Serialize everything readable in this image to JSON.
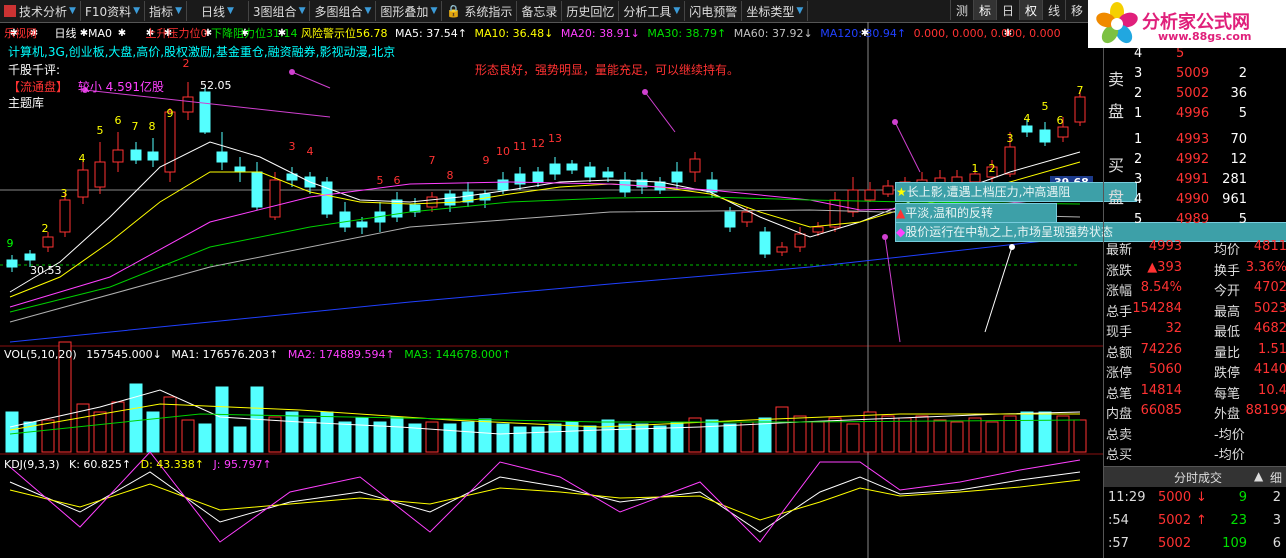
{
  "toolbar": {
    "items": [
      "技术分析",
      "F10资料",
      "指标",
      "日线",
      "3图组合",
      "多图组合",
      "图形叠加",
      "系统指示",
      "备忘录",
      "历史回忆",
      "分析工具",
      "闪电预警",
      "坐标类型"
    ],
    "right": [
      "测",
      "标",
      "日",
      "权",
      "线",
      "移"
    ]
  },
  "logo": {
    "text": "分析家公式网",
    "url": "www.88gs.com"
  },
  "indicator_line": {
    "stock": "乐视网",
    "period": "日线",
    "ma0": "MA0",
    "pressure": "上升压力位0",
    "resistance": "下降阻力位31.14",
    "risk": "风险警示位56.78",
    "ma5": "MA5: 37.54↑",
    "ma10": "MA10: 36.48↓",
    "ma20": "MA20: 38.91↓",
    "ma30": "MA30: 38.79↑",
    "ma60": "MA60: 37.92↓",
    "ma120": "MA120: 30.94↑",
    "tail": "0.000, 0.000, 0.000, 0.000"
  },
  "concepts": "计算机,3G,创业板,大盘,高价,股权激励,基金重仓,融资融券,影视动漫,北京",
  "comment_label": "千股千评:",
  "float_label": "【流通盘】",
  "float_value": "较小 4.591亿股",
  "theme_label": "主题库",
  "advice": "形态良好，强势明显，量能充足，可以继续持有。",
  "price_labels": {
    "high": "52.05",
    "low": "30.53",
    "last": "39.68"
  },
  "callouts": [
    "长上影,遭遇上档压力,冲高遇阻",
    "平淡,温和的反转",
    "股价运行在中轨之上,市场呈现强势状态"
  ],
  "vol_line": {
    "head": "VOL(5,10,20)",
    "v": "157545.000↓",
    "ma1": "MA1: 176576.203↑",
    "ma2": "MA2: 174889.594↑",
    "ma3": "MA3: 144678.000↑"
  },
  "kdj_line": {
    "head": "KDJ(9,3,3)",
    "k": "K: 60.825↑",
    "d": "D: 43.338↑",
    "j": "J: 95.797↑"
  },
  "orderbook": {
    "sell": [
      {
        "lvl": "5",
        "price": "5",
        "vol": ""
      },
      {
        "lvl": "4",
        "price": "5",
        "vol": ""
      },
      {
        "lvl": "3",
        "price": "5009",
        "vol": "2"
      },
      {
        "lvl": "2",
        "price": "5002",
        "vol": "36"
      },
      {
        "lvl": "1",
        "price": "4996",
        "vol": "5"
      }
    ],
    "buy": [
      {
        "lvl": "1",
        "price": "4993",
        "vol": "70"
      },
      {
        "lvl": "2",
        "price": "4992",
        "vol": "12"
      },
      {
        "lvl": "3",
        "price": "4991",
        "vol": "281"
      },
      {
        "lvl": "4",
        "price": "4990",
        "vol": "961"
      },
      {
        "lvl": "5",
        "price": "4989",
        "vol": "5"
      }
    ],
    "sell_label": [
      "卖",
      "盘"
    ],
    "buy_label": [
      "买",
      "盘"
    ]
  },
  "stats": [
    {
      "l": "最新",
      "v": "4993",
      "l2": "均价",
      "v2": "4811"
    },
    {
      "l": "涨跌",
      "v": "▲393",
      "l2": "换手",
      "v2": "3.36%"
    },
    {
      "l": "涨幅",
      "v": "8.54%",
      "l2": "今开",
      "v2": "4702"
    },
    {
      "l": "总手",
      "v": "154284",
      "l2": "最高",
      "v2": "5023"
    },
    {
      "l": "现手",
      "v": "32",
      "l2": "最低",
      "v2": "4682"
    },
    {
      "l": "总额",
      "v": "74226",
      "l2": "量比",
      "v2": "1.51"
    },
    {
      "l": "涨停",
      "v": "5060",
      "l2": "跌停",
      "v2": "4140"
    },
    {
      "l": "总笔",
      "v": "14814",
      "l2": "每笔",
      "v2": "10.4"
    },
    {
      "l": "内盘",
      "v": "66085",
      "l2": "外盘",
      "v2": "88199"
    },
    {
      "l": "总卖",
      "v": "",
      "l2": "-均价",
      "v2": ""
    },
    {
      "l": "总买",
      "v": "",
      "l2": "-均价",
      "v2": ""
    }
  ],
  "ticks_header": "分时成交",
  "ticks_right": "细",
  "ticks": [
    {
      "t": "11:29",
      "p": "5000",
      "arrow": "↓",
      "v": "9",
      "n": "2"
    },
    {
      "t": ":54",
      "p": "5002",
      "arrow": "↑",
      "v": "23",
      "n": "3"
    },
    {
      "t": ":57",
      "p": "5002",
      "arrow": "",
      "v": "109",
      "n": "6"
    }
  ],
  "colors": {
    "up": "#ff3232",
    "down": "#54ffff",
    "ma5": "#ffffff",
    "ma10": "#ffff00",
    "ma20": "#ff40ff",
    "ma30": "#00d000",
    "ma60": "#b0b0b0",
    "ma120": "#2040ff"
  }
}
